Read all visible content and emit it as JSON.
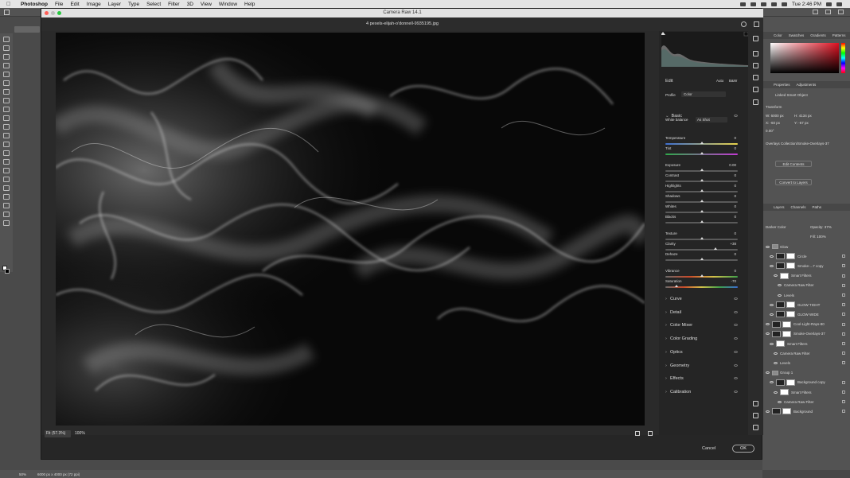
{
  "menubar": {
    "app": "Photoshop",
    "items": [
      "File",
      "Edit",
      "Image",
      "Layer",
      "Type",
      "Select",
      "Filter",
      "3D",
      "View",
      "Window",
      "Help"
    ],
    "clock": "Tue 2:46 PM"
  },
  "acr": {
    "title": "Camera Raw 14.1",
    "filename": "4 pexels-elijah-o'donnell-9935195.jpg",
    "zoom_fit": "Fit (57.3%)",
    "zoom_100": "100%",
    "cancel": "Cancel",
    "ok": "OK"
  },
  "edit": {
    "title": "Edit",
    "auto": "Auto",
    "bw": "B&W",
    "profile_label": "Profile",
    "profile_value": "Color",
    "basic": "Basic",
    "wb_label": "White balance",
    "wb_value": "As Shot"
  },
  "sliders": [
    {
      "label": "Temperature",
      "value": "0",
      "pos": 0.5,
      "kind": "temp"
    },
    {
      "label": "Tint",
      "value": "0",
      "pos": 0.5,
      "kind": "tint"
    },
    {
      "label": "Exposure",
      "value": "0.00",
      "pos": 0.5,
      "kind": "plain"
    },
    {
      "label": "Contrast",
      "value": "0",
      "pos": 0.5,
      "kind": "plain"
    },
    {
      "label": "Highlights",
      "value": "0",
      "pos": 0.5,
      "kind": "plain"
    },
    {
      "label": "Shadows",
      "value": "0",
      "pos": 0.5,
      "kind": "plain"
    },
    {
      "label": "Whites",
      "value": "0",
      "pos": 0.5,
      "kind": "plain"
    },
    {
      "label": "Blacks",
      "value": "0",
      "pos": 0.5,
      "kind": "plain"
    },
    {
      "label": "Texture",
      "value": "0",
      "pos": 0.5,
      "kind": "plain"
    },
    {
      "label": "Clarity",
      "value": "+38",
      "pos": 0.69,
      "kind": "plain"
    },
    {
      "label": "Dehaze",
      "value": "0",
      "pos": 0.5,
      "kind": "plain"
    },
    {
      "label": "Vibrance",
      "value": "0",
      "pos": 0.5,
      "kind": "vib"
    },
    {
      "label": "Saturation",
      "value": "-70",
      "pos": 0.15,
      "kind": "sat"
    }
  ],
  "sections": [
    "Curve",
    "Detail",
    "Color Mixer",
    "Color Grading",
    "Optics",
    "Geometry",
    "Effects",
    "Calibration"
  ],
  "ps_right": {
    "color_tabs": [
      "Color",
      "Swatches",
      "Gradients",
      "Patterns"
    ],
    "prop_tabs": [
      "Properties",
      "Adjustments"
    ],
    "smart_object": "Linked Smart Object",
    "transform": "Transform",
    "w": "W: 6000 px",
    "h": "H: 4134 px",
    "x": "X: -60 px",
    "y": "Y: -67 px",
    "angle": "0.00°",
    "linked_path": "Overlays Collection/Smoke-Overlays-37",
    "edit_contents": "Edit Contents",
    "convert": "Convert to Layers",
    "layer_tabs": [
      "Layers",
      "Channels",
      "Paths"
    ],
    "blend": "Darker Color",
    "opacity": "Opacity: 37%",
    "fill": "Fill: 100%",
    "layers": [
      {
        "name": "Glow",
        "kind": "group",
        "indent": 0
      },
      {
        "name": "Circle",
        "kind": "layer",
        "indent": 1
      },
      {
        "name": "Smoke-...7 copy",
        "kind": "smart",
        "indent": 1
      },
      {
        "name": "Smart Filters",
        "kind": "filter",
        "indent": 2
      },
      {
        "name": "Camera Raw Filter",
        "kind": "sub",
        "indent": 3
      },
      {
        "name": "Levels",
        "kind": "sub",
        "indent": 3
      },
      {
        "name": "GLOW TIGHT",
        "kind": "layer",
        "indent": 1
      },
      {
        "name": "GLOW WIDE",
        "kind": "layer",
        "indent": 1
      },
      {
        "name": "Cool-Light-Rays-80",
        "kind": "layer",
        "indent": 0
      },
      {
        "name": "Smoke-Overlays-37",
        "kind": "layer",
        "indent": 0
      },
      {
        "name": "Smart Filters",
        "kind": "filter",
        "indent": 1
      },
      {
        "name": "Camera Raw Filter",
        "kind": "sub",
        "indent": 2
      },
      {
        "name": "Levels",
        "kind": "sub",
        "indent": 2
      },
      {
        "name": "Group 1",
        "kind": "group",
        "indent": 0
      },
      {
        "name": "Background copy",
        "kind": "smart",
        "indent": 1
      },
      {
        "name": "Smart Filters",
        "kind": "filter",
        "indent": 2
      },
      {
        "name": "Camera Raw Filter",
        "kind": "sub",
        "indent": 3
      },
      {
        "name": "Background",
        "kind": "layer",
        "indent": 0
      }
    ]
  },
  "status": {
    "zoom": "50%",
    "doc": "6000 px x 4000 px (72 ppi)"
  }
}
